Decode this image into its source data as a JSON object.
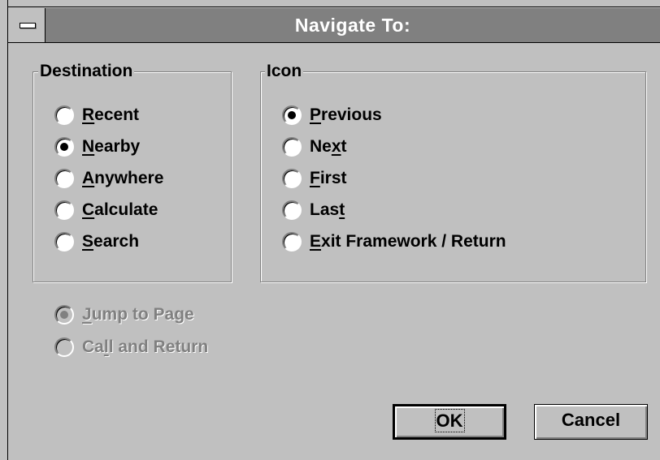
{
  "title": "Navigate To:",
  "destination": {
    "label": "Destination",
    "options": [
      {
        "pre": "",
        "u": "R",
        "post": "ecent",
        "checked": false
      },
      {
        "pre": "",
        "u": "N",
        "post": "earby",
        "checked": true
      },
      {
        "pre": "",
        "u": "A",
        "post": "nywhere",
        "checked": false
      },
      {
        "pre": "",
        "u": "C",
        "post": "alculate",
        "checked": false
      },
      {
        "pre": "",
        "u": "S",
        "post": "earch",
        "checked": false
      }
    ]
  },
  "icon": {
    "label": "Icon",
    "options": [
      {
        "pre": "",
        "u": "P",
        "post": "revious",
        "checked": true
      },
      {
        "pre": "Ne",
        "u": "x",
        "post": "t",
        "checked": false
      },
      {
        "pre": "",
        "u": "F",
        "post": "irst",
        "checked": false
      },
      {
        "pre": "Las",
        "u": "t",
        "post": "",
        "checked": false
      },
      {
        "pre": "",
        "u": "E",
        "post": "xit Framework / Return",
        "checked": false
      }
    ]
  },
  "mode": {
    "options": [
      {
        "pre": "",
        "u": "J",
        "post": "ump to Page",
        "checked": true,
        "disabled": true
      },
      {
        "pre": "Ca",
        "u": "l",
        "post": "l and Return",
        "checked": false,
        "disabled": true
      }
    ]
  },
  "buttons": {
    "ok": "OK",
    "cancel": "Cancel"
  }
}
